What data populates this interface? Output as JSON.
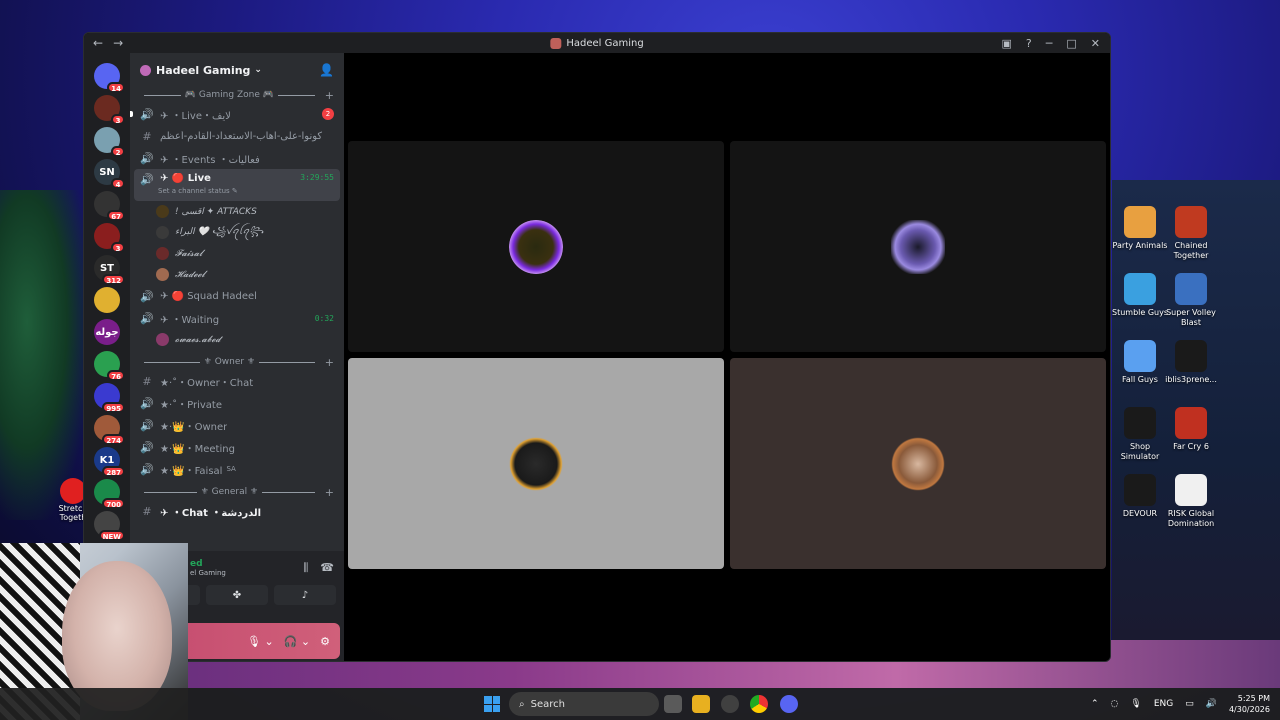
{
  "window": {
    "title": "Hadeel Gaming",
    "back": "←",
    "forward": "→"
  },
  "guilds": [
    {
      "label": "",
      "badge": "14",
      "color": "#5865f2"
    },
    {
      "label": "",
      "badge": "3",
      "color": "#6b2a20"
    },
    {
      "label": "",
      "badge": "2",
      "color": "#7aa0b0"
    },
    {
      "label": "SN",
      "badge": "4",
      "color": "#2d3a44"
    },
    {
      "label": "",
      "badge": "67",
      "color": "#333"
    },
    {
      "label": "",
      "badge": "3",
      "color": "#8a1e1e"
    },
    {
      "label": "ST",
      "badge": "312",
      "color": "#2a2a2a"
    },
    {
      "label": "",
      "badge": "",
      "color": "#e0b030"
    },
    {
      "label": "جوله",
      "badge": "",
      "color": "#7a1e8a"
    },
    {
      "label": "",
      "badge": "76",
      "color": "#2aa050"
    },
    {
      "label": "",
      "badge": "995",
      "color": "#3a3ad0"
    },
    {
      "label": "",
      "badge": "274",
      "color": "#a05a3a"
    },
    {
      "label": "K1",
      "badge": "287",
      "color": "#1a3a8a"
    },
    {
      "label": "",
      "badge": "700",
      "color": "#1a8a4a"
    },
    {
      "label": "",
      "badge": "NEW",
      "color": "#444"
    }
  ],
  "server": {
    "name": "Hadeel Gaming",
    "caret": "⌄",
    "invite_icon": "👤"
  },
  "categories": {
    "gaming_zone": "🎮 Gaming Zone 🎮",
    "owner": "⚜ Owner ⚜",
    "general": "⚜ General ⚜"
  },
  "channels": {
    "live_top": {
      "name": "✈ ・Live・لايف",
      "mention": "2"
    },
    "text_ready": {
      "name": "كونوا-على-اهاب-الاستعداد-القادم-أعظم"
    },
    "events": {
      "name": "✈ ・Events ・فعاليات"
    },
    "live_active": {
      "name": "✈ 🔴 Live",
      "time": "3:29:55",
      "status": "Set a channel status ✎"
    },
    "squad": {
      "name": "✈ 🔴 Squad Hadeel"
    },
    "waiting": {
      "name": "✈ ・Waiting",
      "time": "0:32"
    },
    "owner_chat": {
      "name": "★·˚・Owner・Chat"
    },
    "private": {
      "name": "★·˚・Private"
    },
    "owner": {
      "name": "★·👑・Owner"
    },
    "meeting": {
      "name": "★·👑・Meeting"
    },
    "faisal": {
      "name": "★·👑・Faisal",
      "tag": "SA"
    },
    "chat": {
      "name": "✈ ・Chat ・الدردشة"
    }
  },
  "voice_users": {
    "live": [
      "! اقسى ✦ ATTACKS",
      "البراء 🤍 ꧁ꪜꪖꪶꪖ꧂",
      "𝓕𝓪𝓲𝓼𝓪𝓵",
      "𝓗𝓪𝓭𝓮𝓮𝓵"
    ],
    "waiting": [
      "𝓸𝔀𝓪𝓮𝓼.𝓪𝓫𝓮𝓭"
    ]
  },
  "voice_panel": {
    "status": "ed",
    "server": "el Gaming"
  },
  "desktop_icons": [
    {
      "label": "Party Animals",
      "color": "#e8a040"
    },
    {
      "label": "Chained Together",
      "color": "#c03a20"
    },
    {
      "label": "Stumble Guys",
      "color": "#3aa0e0"
    },
    {
      "label": "Super Volley Blast",
      "color": "#3a70c0"
    },
    {
      "label": "Fall Guys",
      "color": "#5aa0f0"
    },
    {
      "label": "iblis3prene...",
      "color": "#1a1a1a"
    },
    {
      "label": "Shop Simulator",
      "color": "#1a1a1a"
    },
    {
      "label": "Far Cry 6",
      "color": "#c03020"
    },
    {
      "label": "DEVOUR",
      "color": "#1a1a1a"
    },
    {
      "label": "RISK Global Domination",
      "color": "#f0f0f0"
    }
  ],
  "stretch_icon": {
    "label": "Stretch Togeth"
  },
  "taskbar": {
    "search": "Search",
    "lang": "ENG",
    "time": "5:25 PM",
    "date": "4/30/2026"
  }
}
